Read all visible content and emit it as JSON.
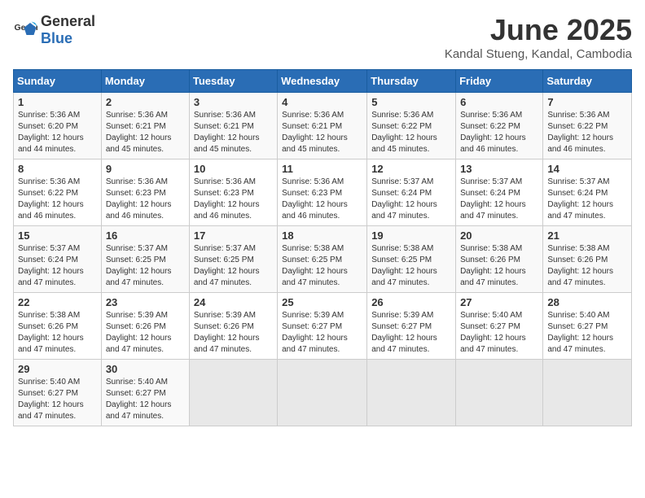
{
  "header": {
    "logo_general": "General",
    "logo_blue": "Blue",
    "month_year": "June 2025",
    "location": "Kandal Stueng, Kandal, Cambodia"
  },
  "weekdays": [
    "Sunday",
    "Monday",
    "Tuesday",
    "Wednesday",
    "Thursday",
    "Friday",
    "Saturday"
  ],
  "weeks": [
    [
      {
        "day": "1",
        "sunrise": "5:36 AM",
        "sunset": "6:20 PM",
        "daylight": "12 hours and 44 minutes."
      },
      {
        "day": "2",
        "sunrise": "5:36 AM",
        "sunset": "6:21 PM",
        "daylight": "12 hours and 45 minutes."
      },
      {
        "day": "3",
        "sunrise": "5:36 AM",
        "sunset": "6:21 PM",
        "daylight": "12 hours and 45 minutes."
      },
      {
        "day": "4",
        "sunrise": "5:36 AM",
        "sunset": "6:21 PM",
        "daylight": "12 hours and 45 minutes."
      },
      {
        "day": "5",
        "sunrise": "5:36 AM",
        "sunset": "6:22 PM",
        "daylight": "12 hours and 45 minutes."
      },
      {
        "day": "6",
        "sunrise": "5:36 AM",
        "sunset": "6:22 PM",
        "daylight": "12 hours and 46 minutes."
      },
      {
        "day": "7",
        "sunrise": "5:36 AM",
        "sunset": "6:22 PM",
        "daylight": "12 hours and 46 minutes."
      }
    ],
    [
      {
        "day": "8",
        "sunrise": "5:36 AM",
        "sunset": "6:22 PM",
        "daylight": "12 hours and 46 minutes."
      },
      {
        "day": "9",
        "sunrise": "5:36 AM",
        "sunset": "6:23 PM",
        "daylight": "12 hours and 46 minutes."
      },
      {
        "day": "10",
        "sunrise": "5:36 AM",
        "sunset": "6:23 PM",
        "daylight": "12 hours and 46 minutes."
      },
      {
        "day": "11",
        "sunrise": "5:36 AM",
        "sunset": "6:23 PM",
        "daylight": "12 hours and 46 minutes."
      },
      {
        "day": "12",
        "sunrise": "5:37 AM",
        "sunset": "6:24 PM",
        "daylight": "12 hours and 47 minutes."
      },
      {
        "day": "13",
        "sunrise": "5:37 AM",
        "sunset": "6:24 PM",
        "daylight": "12 hours and 47 minutes."
      },
      {
        "day": "14",
        "sunrise": "5:37 AM",
        "sunset": "6:24 PM",
        "daylight": "12 hours and 47 minutes."
      }
    ],
    [
      {
        "day": "15",
        "sunrise": "5:37 AM",
        "sunset": "6:24 PM",
        "daylight": "12 hours and 47 minutes."
      },
      {
        "day": "16",
        "sunrise": "5:37 AM",
        "sunset": "6:25 PM",
        "daylight": "12 hours and 47 minutes."
      },
      {
        "day": "17",
        "sunrise": "5:37 AM",
        "sunset": "6:25 PM",
        "daylight": "12 hours and 47 minutes."
      },
      {
        "day": "18",
        "sunrise": "5:38 AM",
        "sunset": "6:25 PM",
        "daylight": "12 hours and 47 minutes."
      },
      {
        "day": "19",
        "sunrise": "5:38 AM",
        "sunset": "6:25 PM",
        "daylight": "12 hours and 47 minutes."
      },
      {
        "day": "20",
        "sunrise": "5:38 AM",
        "sunset": "6:26 PM",
        "daylight": "12 hours and 47 minutes."
      },
      {
        "day": "21",
        "sunrise": "5:38 AM",
        "sunset": "6:26 PM",
        "daylight": "12 hours and 47 minutes."
      }
    ],
    [
      {
        "day": "22",
        "sunrise": "5:38 AM",
        "sunset": "6:26 PM",
        "daylight": "12 hours and 47 minutes."
      },
      {
        "day": "23",
        "sunrise": "5:39 AM",
        "sunset": "6:26 PM",
        "daylight": "12 hours and 47 minutes."
      },
      {
        "day": "24",
        "sunrise": "5:39 AM",
        "sunset": "6:26 PM",
        "daylight": "12 hours and 47 minutes."
      },
      {
        "day": "25",
        "sunrise": "5:39 AM",
        "sunset": "6:27 PM",
        "daylight": "12 hours and 47 minutes."
      },
      {
        "day": "26",
        "sunrise": "5:39 AM",
        "sunset": "6:27 PM",
        "daylight": "12 hours and 47 minutes."
      },
      {
        "day": "27",
        "sunrise": "5:40 AM",
        "sunset": "6:27 PM",
        "daylight": "12 hours and 47 minutes."
      },
      {
        "day": "28",
        "sunrise": "5:40 AM",
        "sunset": "6:27 PM",
        "daylight": "12 hours and 47 minutes."
      }
    ],
    [
      {
        "day": "29",
        "sunrise": "5:40 AM",
        "sunset": "6:27 PM",
        "daylight": "12 hours and 47 minutes."
      },
      {
        "day": "30",
        "sunrise": "5:40 AM",
        "sunset": "6:27 PM",
        "daylight": "12 hours and 47 minutes."
      },
      null,
      null,
      null,
      null,
      null
    ]
  ],
  "labels": {
    "sunrise": "Sunrise:",
    "sunset": "Sunset:",
    "daylight": "Daylight:"
  }
}
